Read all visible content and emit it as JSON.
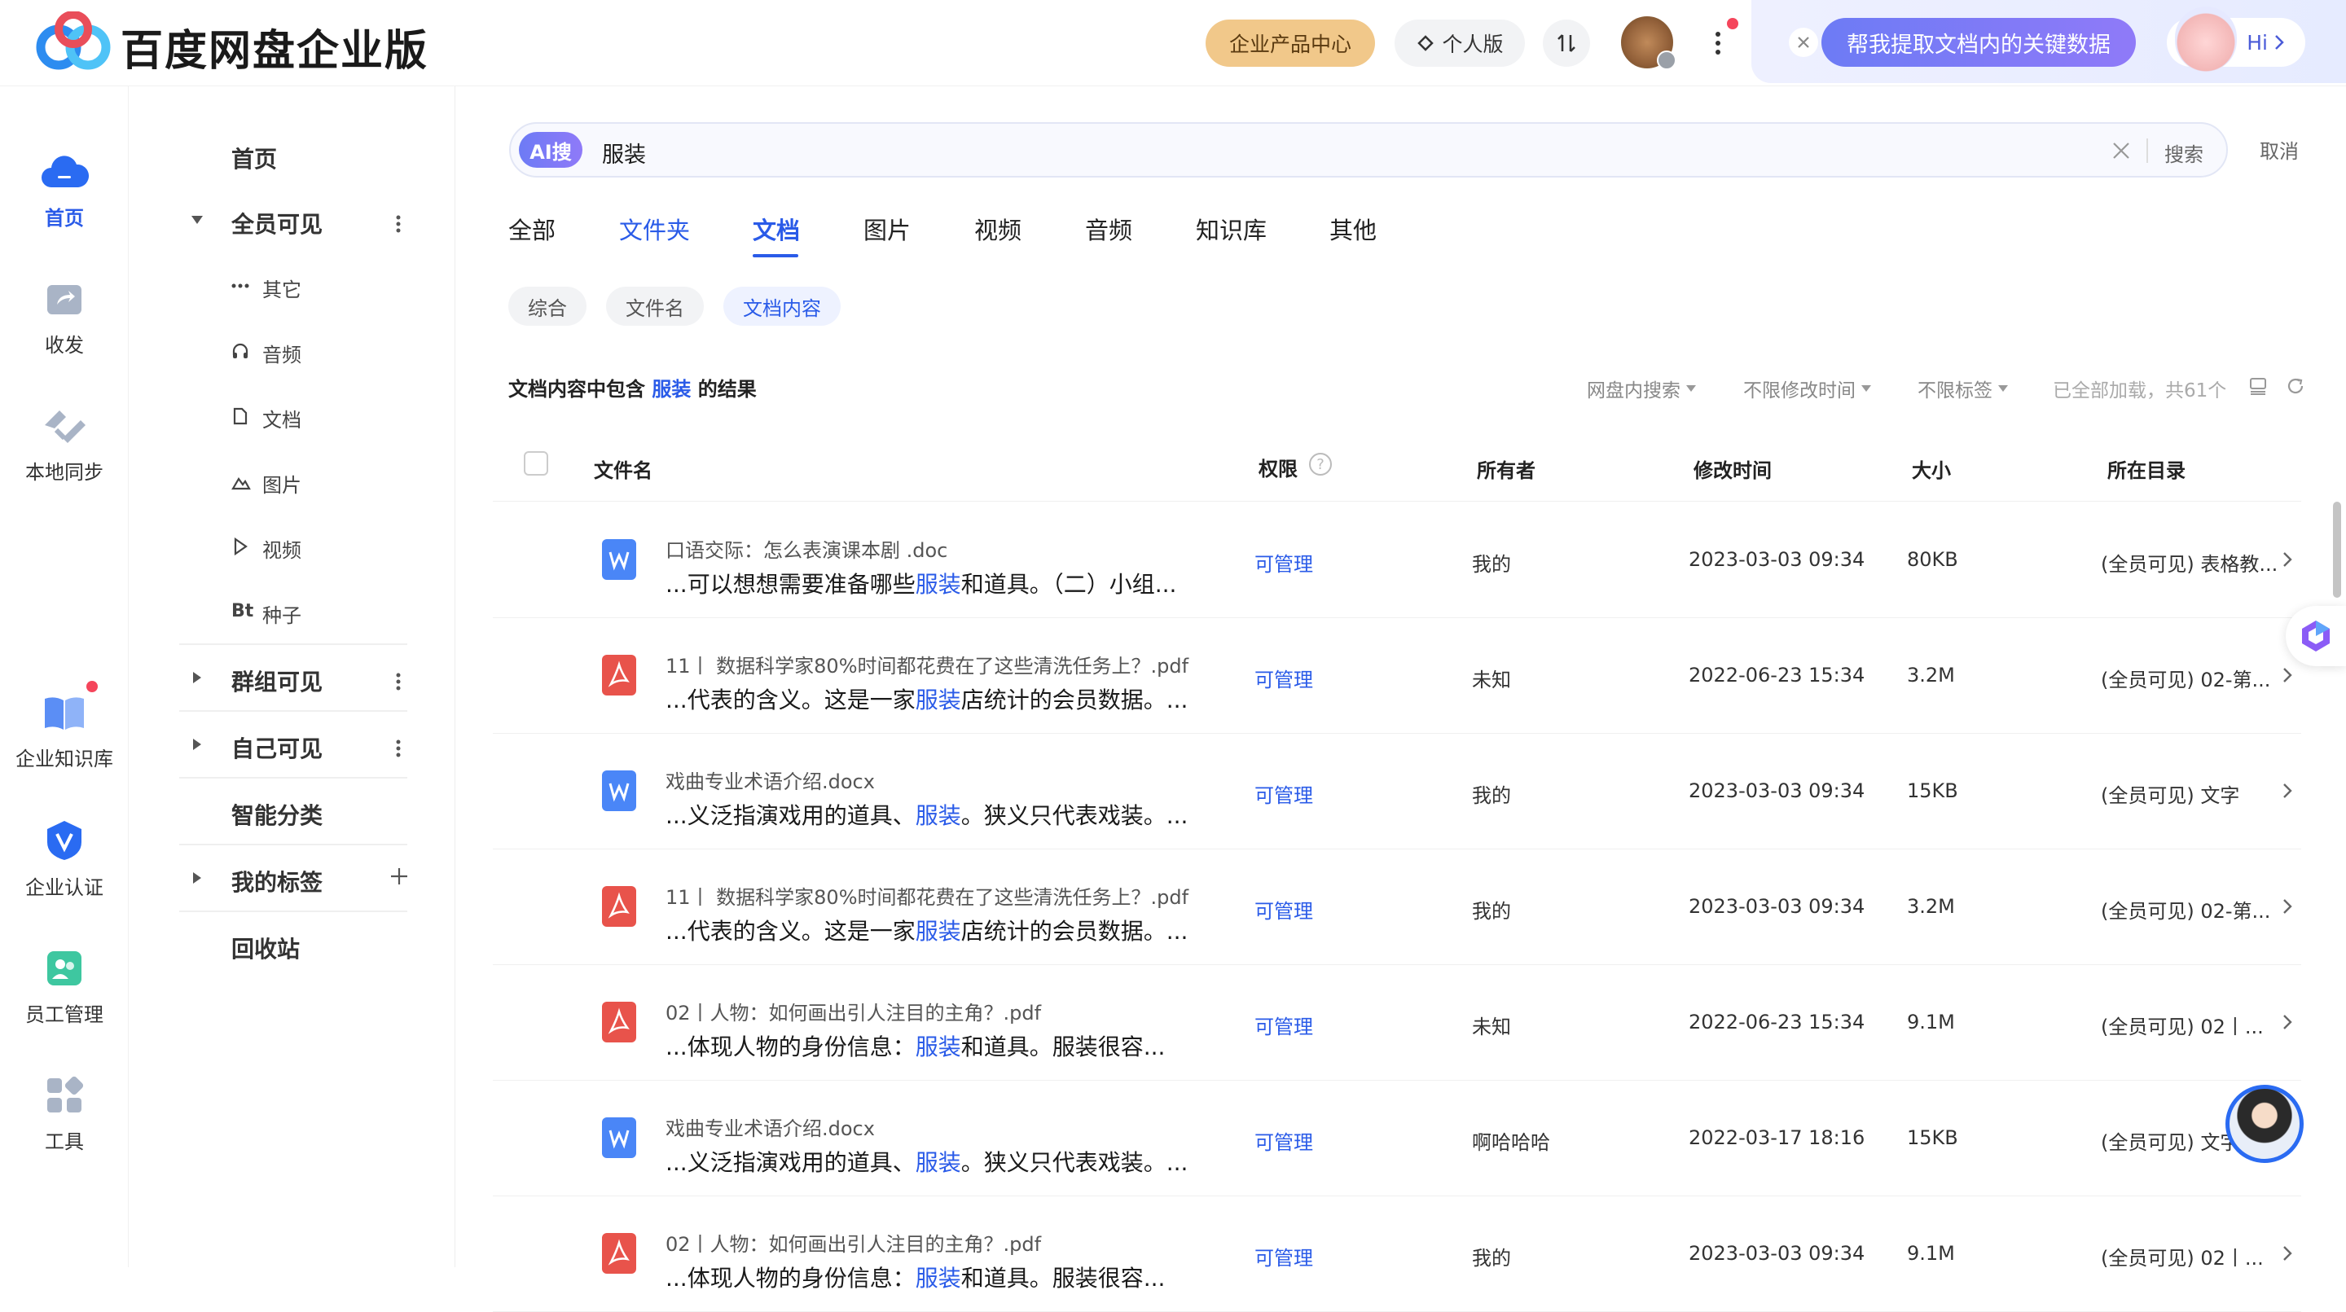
{
  "app": {
    "title": "百度网盘企业版"
  },
  "header": {
    "product_center": "企业产品中心",
    "personal_edition": "个人版",
    "ai_banner_text": "帮我提取文档内的关键数据",
    "hi_label": "Hi"
  },
  "rail": {
    "items": [
      {
        "label": "首页",
        "icon": "cloud-icon"
      },
      {
        "label": "收发",
        "icon": "share-icon"
      },
      {
        "label": "本地同步",
        "icon": "sync-icon"
      },
      {
        "label": "企业知识库",
        "icon": "book-icon"
      },
      {
        "label": "企业认证",
        "icon": "verify-icon"
      },
      {
        "label": "员工管理",
        "icon": "staff-icon"
      },
      {
        "label": "工具",
        "icon": "tools-icon"
      }
    ]
  },
  "nav": {
    "home": "首页",
    "all_visible": "全员可见",
    "sub_items": [
      "其它",
      "音频",
      "文档",
      "图片",
      "视频",
      "种子"
    ],
    "group_visible": "群组可见",
    "self_visible": "自己可见",
    "smart_category": "智能分类",
    "my_tags": "我的标签",
    "recycle_bin": "回收站"
  },
  "search": {
    "badge": "AI搜",
    "query": "服装",
    "search_label": "搜索",
    "cancel_label": "取消"
  },
  "tabs": [
    "全部",
    "文件夹",
    "文档",
    "图片",
    "视频",
    "音频",
    "知识库",
    "其他"
  ],
  "active_tab": "文档",
  "chips": [
    "综合",
    "文件名",
    "文档内容"
  ],
  "result_info": {
    "prefix": "文档内容中包含",
    "keyword": "服装",
    "suffix": "的结果",
    "filter_scope": "网盘内搜索",
    "filter_time": "不限修改时间",
    "filter_tag": "不限标签",
    "count_text": "已全部加载，共61个"
  },
  "table": {
    "headers": {
      "name": "文件名",
      "perm": "权限",
      "owner": "所有者",
      "modified": "修改时间",
      "size": "大小",
      "dir": "所在目录"
    },
    "rows": [
      {
        "type": "word",
        "name": "口语交际：怎么表演课本剧 .doc",
        "pre": "...可以想想需要准备哪些",
        "hl": "服装",
        "post": "和道具。（二）小组...",
        "perm": "可管理",
        "owner": "我的",
        "time": "2023-03-03 09:34",
        "size": "80KB",
        "dir": "(全员可见) 表格教..."
      },
      {
        "type": "pdf",
        "name": "11丨 数据科学家80%时间都花费在了这些清洗任务上？.pdf",
        "pre": "...代表的含义。这是一家",
        "hl": "服装",
        "post": "店统计的会员数据。...",
        "perm": "可管理",
        "owner": "未知",
        "time": "2022-06-23 15:34",
        "size": "3.2M",
        "dir": "(全员可见) 02-第..."
      },
      {
        "type": "word",
        "name": "戏曲专业术语介绍.docx",
        "pre": "...义泛指演戏用的道具、",
        "hl": "服装",
        "post": "。狭义只代表戏装。...",
        "perm": "可管理",
        "owner": "我的",
        "time": "2023-03-03 09:34",
        "size": "15KB",
        "dir": "(全员可见) 文字"
      },
      {
        "type": "pdf",
        "name": "11丨 数据科学家80%时间都花费在了这些清洗任务上？.pdf",
        "pre": "...代表的含义。这是一家",
        "hl": "服装",
        "post": "店统计的会员数据。...",
        "perm": "可管理",
        "owner": "我的",
        "time": "2023-03-03 09:34",
        "size": "3.2M",
        "dir": "(全员可见) 02-第..."
      },
      {
        "type": "pdf",
        "name": "02丨人物：如何画出引人注目的主角？.pdf",
        "pre": "...体现人物的身份信息：",
        "hl": "服装",
        "post": "和道具。服装很容...",
        "perm": "可管理",
        "owner": "未知",
        "time": "2022-06-23 15:34",
        "size": "9.1M",
        "dir": "(全员可见) 02丨..."
      },
      {
        "type": "word",
        "name": "戏曲专业术语介绍.docx",
        "pre": "...义泛指演戏用的道具、",
        "hl": "服装",
        "post": "。狭义只代表戏装。...",
        "perm": "可管理",
        "owner": "啊哈哈哈",
        "time": "2022-03-17 18:16",
        "size": "15KB",
        "dir": "(全员可见) 文字"
      },
      {
        "type": "pdf",
        "name": "02丨人物：如何画出引人注目的主角？.pdf",
        "pre": "...体现人物的身份信息：",
        "hl": "服装",
        "post": "和道具。服装很容...",
        "perm": "可管理",
        "owner": "我的",
        "time": "2023-03-03 09:34",
        "size": "9.1M",
        "dir": "(全员可见) 02丨..."
      }
    ]
  },
  "colors": {
    "accent": "#2a5be8",
    "pdf": "#e8534b",
    "word": "#4a86f7",
    "brand_gold": "#f1c27a"
  }
}
